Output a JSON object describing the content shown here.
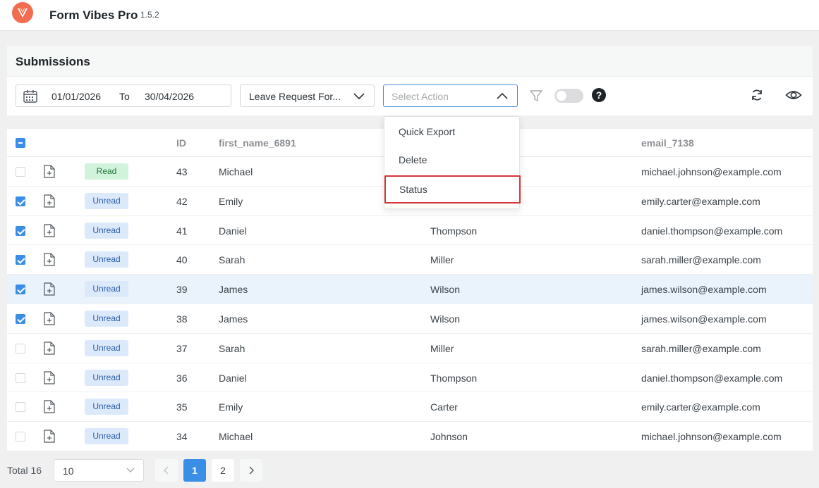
{
  "app": {
    "title": "Form Vibes Pro",
    "version": "1.5.2"
  },
  "panel": {
    "title": "Submissions"
  },
  "filters": {
    "date_from": "01/01/2026",
    "date_to_label": "To",
    "date_to": "30/04/2026",
    "form_select": "Leave Request For...",
    "action_placeholder": "Select Action"
  },
  "action_menu": {
    "items": [
      {
        "label": "Quick Export"
      },
      {
        "label": "Delete"
      },
      {
        "label": "Status"
      }
    ]
  },
  "table": {
    "headers": {
      "id": "ID",
      "first_name": "first_name_6891",
      "email": "email_7138"
    },
    "rows": [
      {
        "checked": false,
        "status": "Read",
        "id": "43",
        "first_name": "Michael",
        "last_name": "",
        "email": "michael.johnson@example.com"
      },
      {
        "checked": true,
        "status": "Unread",
        "id": "42",
        "first_name": "Emily",
        "last_name": "",
        "email": "emily.carter@example.com"
      },
      {
        "checked": true,
        "status": "Unread",
        "id": "41",
        "first_name": "Daniel",
        "last_name": "Thompson",
        "email": "daniel.thompson@example.com"
      },
      {
        "checked": true,
        "status": "Unread",
        "id": "40",
        "first_name": "Sarah",
        "last_name": "Miller",
        "email": "sarah.miller@example.com"
      },
      {
        "checked": true,
        "status": "Unread",
        "id": "39",
        "first_name": "James",
        "last_name": "Wilson",
        "email": "james.wilson@example.com"
      },
      {
        "checked": true,
        "status": "Unread",
        "id": "38",
        "first_name": "James",
        "last_name": "Wilson",
        "email": "james.wilson@example.com"
      },
      {
        "checked": false,
        "status": "Unread",
        "id": "37",
        "first_name": "Sarah",
        "last_name": "Miller",
        "email": "sarah.miller@example.com"
      },
      {
        "checked": false,
        "status": "Unread",
        "id": "36",
        "first_name": "Daniel",
        "last_name": "Thompson",
        "email": "daniel.thompson@example.com"
      },
      {
        "checked": false,
        "status": "Unread",
        "id": "35",
        "first_name": "Emily",
        "last_name": "Carter",
        "email": "emily.carter@example.com"
      },
      {
        "checked": false,
        "status": "Unread",
        "id": "34",
        "first_name": "Michael",
        "last_name": "Johnson",
        "email": "michael.johnson@example.com"
      }
    ]
  },
  "pagination": {
    "total_label": "Total 16",
    "page_size": "10",
    "pages": [
      "1",
      "2"
    ],
    "current_page": "1"
  },
  "colors": {
    "brand": "#f26c4f",
    "accent": "#3a8ee6",
    "outline": "#d63638"
  }
}
